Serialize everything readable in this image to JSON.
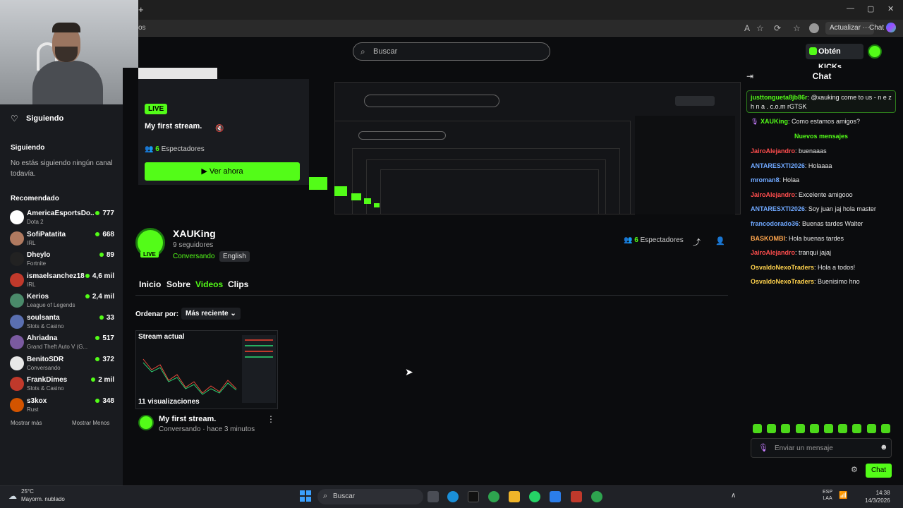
{
  "browser": {
    "address_partial": "os",
    "update_label": "Actualizar",
    "chat_tab_label": "Chat"
  },
  "header": {
    "search_placeholder": "Buscar",
    "kicks_button": "Obtén KICKs"
  },
  "sidebar": {
    "following_header": "Siguiendo",
    "following_section": "Siguiendo",
    "following_empty": "No estás siguiendo ningún canal todavía.",
    "recommended_header": "Recomendado",
    "items": [
      {
        "name": "AmericaEsportsDo...",
        "category": "Dota 2",
        "viewers": "777",
        "color": "#ffffff"
      },
      {
        "name": "SofiPatatita",
        "category": "IRL",
        "viewers": "668",
        "color": "#b07a60"
      },
      {
        "name": "Dheylo",
        "category": "Fortnite",
        "viewers": "89",
        "color": "#222222"
      },
      {
        "name": "ismaelsanchez18",
        "category": "IRL",
        "viewers": "4,6 mil",
        "color": "#c0392b"
      },
      {
        "name": "Kerios",
        "category": "League of Legends",
        "viewers": "2,4 mil",
        "color": "#4a8a6a"
      },
      {
        "name": "soulsanta",
        "category": "Slots & Casino",
        "viewers": "33",
        "color": "#5a6fb0"
      },
      {
        "name": "Ahriadna",
        "category": "Grand Theft Auto V (G...",
        "viewers": "517",
        "color": "#7a5aa0"
      },
      {
        "name": "BenitoSDR",
        "category": "Conversando",
        "viewers": "372",
        "color": "#e8e8e8"
      },
      {
        "name": "FrankDimes",
        "category": "Slots & Casino",
        "viewers": "2 mil",
        "color": "#c0392b"
      },
      {
        "name": "s3kox",
        "category": "Rust",
        "viewers": "348",
        "color": "#d35400"
      }
    ],
    "show_more": "Mostrar más",
    "show_less": "Mostrar Menos"
  },
  "preview": {
    "live_badge": "LIVE",
    "title": "My first stream.",
    "viewers_count": "6",
    "viewers_label": "Espectadores",
    "watch_button": "Ver ahora"
  },
  "channel": {
    "name": "XAUKing",
    "followers": "9 seguidores",
    "live_badge": "LIVE",
    "category": "Conversando",
    "language": "English",
    "viewers_count": "6",
    "viewers_label": "Espectadores",
    "tabs": [
      "Inicio",
      "Sobre",
      "Videos",
      "Clips"
    ],
    "active_tab": "Videos",
    "sort_label": "Ordenar por:",
    "sort_value": "Más reciente"
  },
  "video": {
    "tag": "Stream actual",
    "views": "11 visualizaciones",
    "title": "My first stream.",
    "subtitle": "Conversando · hace 3 minutos"
  },
  "chat": {
    "title": "Chat",
    "pinned_user": "justtongueta8jb86r",
    "pinned_text": ": @xauking come to us - n e z h n a . c.o.m rGTSK",
    "streamer_user": "XAUKing",
    "streamer_text": ": Como estamos amigos?",
    "new_messages": "Nuevos mensajes",
    "messages": [
      {
        "user": "JairoAlejandro",
        "text": ": buenaaas",
        "color": "#ff4d4d"
      },
      {
        "user": "ANTARESXTI2026",
        "text": ": Holaaaa",
        "color": "#6fa8ff"
      },
      {
        "user": "mroman8",
        "text": ": Holaa",
        "color": "#6fa8ff"
      },
      {
        "user": "JairoAlejandro",
        "text": ": Excelente amigooo",
        "color": "#ff4d4d"
      },
      {
        "user": "ANTARESXTI2026",
        "text": ": Soy juan jaj hola master",
        "color": "#6fa8ff"
      },
      {
        "user": "francodorado36",
        "text": ": Buenas tardes Walter",
        "color": "#6fa8ff"
      },
      {
        "user": "BASKOMBI",
        "text": ": Hola buenas tardes",
        "color": "#ffa64d"
      },
      {
        "user": "JairoAlejandro",
        "text": ": tranqui jajaj",
        "color": "#ff4d4d"
      },
      {
        "user": "OsvaldoNexoTraders",
        "text": ": Hola a todos!",
        "color": "#ffd24d"
      },
      {
        "user": "OsvaldoNexoTraders",
        "text": ": Buenisimo hno",
        "color": "#ffd24d"
      }
    ],
    "input_placeholder": "Enviar un mensaje",
    "send_button": "Chat"
  },
  "taskbar": {
    "temp": "25°C",
    "weather": "Mayorm. nublado",
    "search": "Buscar",
    "lang1": "ESP",
    "lang2": "LAA",
    "time": "14:38",
    "date": "14/3/2026"
  },
  "colors": {
    "accent": "#53fc18",
    "bg": "#0b0c0e",
    "panel": "#191b1f"
  }
}
